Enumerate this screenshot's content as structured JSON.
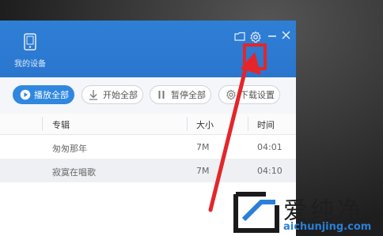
{
  "device": {
    "label": "我的设备",
    "icon": "phone-icon"
  },
  "window_controls": {
    "icons": [
      "folder-icon",
      "gear-icon",
      "minimize-icon",
      "close-icon"
    ]
  },
  "toolbar": {
    "play_all": "播放全部",
    "start_all": "开始全部",
    "pause_all": "暂停全部",
    "download_settings": "下载设置"
  },
  "table": {
    "columns": [
      "专辑",
      "大小",
      "时间"
    ],
    "rows": [
      {
        "album": "匆匆那年",
        "size": "7M",
        "time": "04:01"
      },
      {
        "album": "寂寞在唱歌",
        "size": "7M",
        "time": "04:10"
      }
    ]
  },
  "watermark": {
    "name": "爱纯净",
    "url": "aichunjing.com"
  },
  "colors": {
    "accent": "#2f7fd6",
    "highlight": "#e3262a",
    "watermark_blue": "#2a7fd8"
  }
}
